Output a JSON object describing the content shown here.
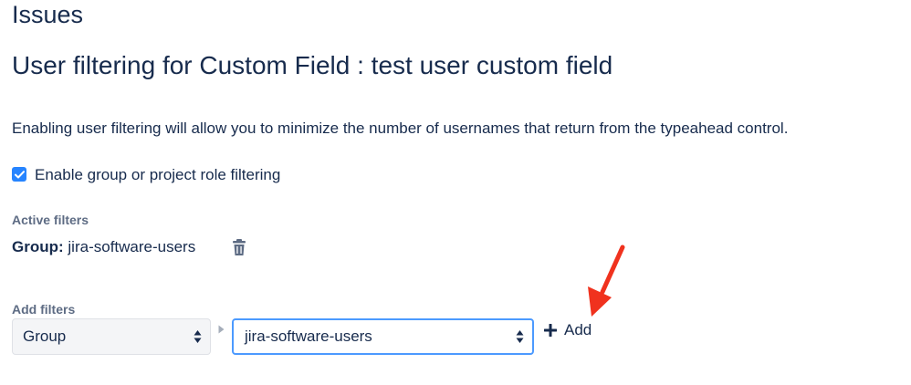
{
  "header": {
    "section_title": "Issues",
    "page_title": "User filtering for Custom Field : test user custom field"
  },
  "description": "Enabling user filtering will allow you to minimize the number of usernames that return from the typeahead control.",
  "enable_filtering": {
    "label": "Enable group or project role filtering",
    "checked": true
  },
  "active_filters": {
    "label": "Active filters",
    "items": [
      {
        "type": "Group",
        "separator": ":",
        "value": "jira-software-users",
        "icon": "trash-icon"
      }
    ]
  },
  "add_filters": {
    "label": "Add filters",
    "type_select": {
      "selected": "Group"
    },
    "value_select": {
      "selected": "jira-software-users"
    },
    "add_button": {
      "label": "Add",
      "icon": "plus-icon"
    }
  },
  "colors": {
    "text": "#172b4d",
    "subtle_text": "#5e6c84",
    "checkbox": "#2684ff",
    "focus_border": "#4c9aff",
    "annotation_arrow": "#f0321e"
  }
}
